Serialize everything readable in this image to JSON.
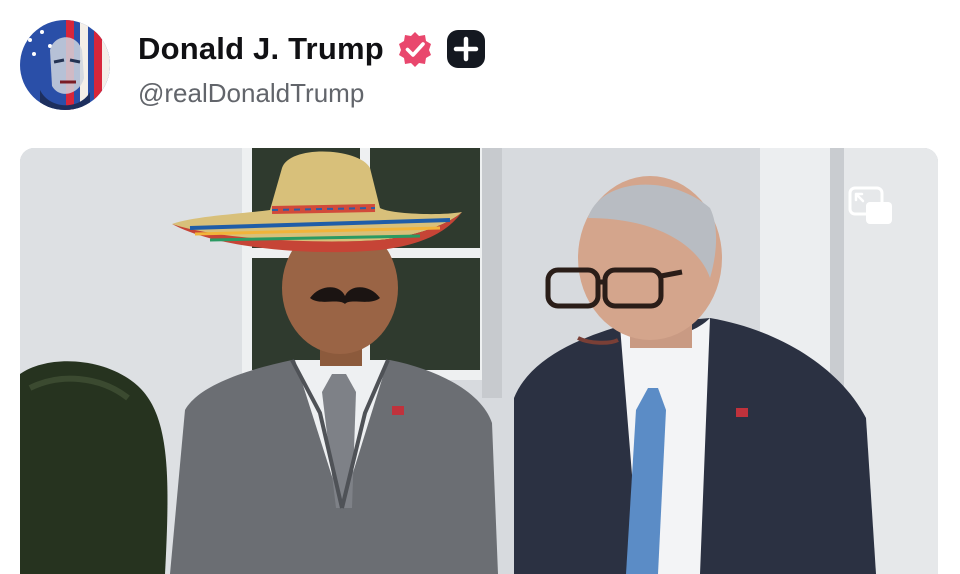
{
  "post": {
    "author": {
      "display_name": "Donald J. Trump",
      "handle": "@realDonaldTrump",
      "verified_badge_color": "#e9476d",
      "avatar_description": "stylized flag portrait avatar"
    },
    "media": {
      "type": "video",
      "pip_icon": "picture-in-picture-icon"
    }
  },
  "colors": {
    "name_text": "#111114",
    "handle_text": "#62656b",
    "badge_pink": "#e9476d",
    "plus_badge_bg": "#141820"
  }
}
